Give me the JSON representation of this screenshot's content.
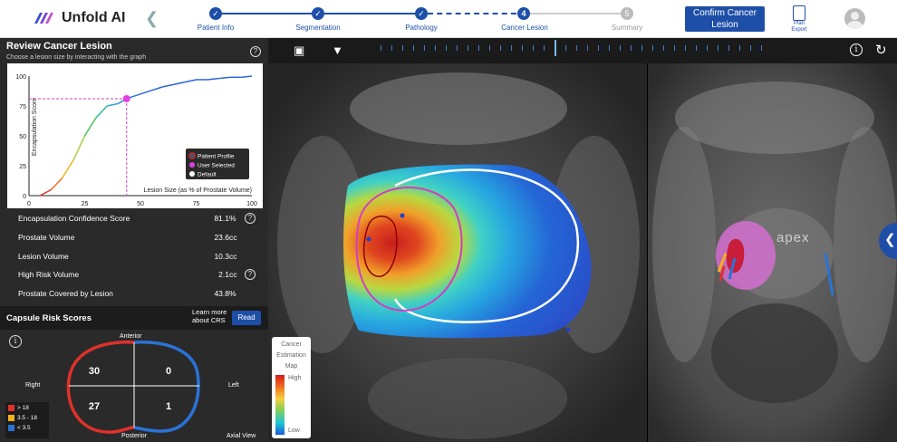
{
  "header": {
    "app_name": "Unfold AI",
    "steps": [
      {
        "number": "",
        "label": "Patient Info",
        "state": "done"
      },
      {
        "number": "",
        "label": "Segmentation",
        "state": "done"
      },
      {
        "number": "",
        "label": "Pathology",
        "state": "done"
      },
      {
        "number": "4",
        "label": "Cancer Lesion",
        "state": "current"
      },
      {
        "number": "5",
        "label": "Summary",
        "state": "todo"
      }
    ],
    "confirm_label": "Confirm Cancer Lesion",
    "plan_export_label": "Plan Export"
  },
  "review": {
    "title": "Review Cancer Lesion",
    "subtitle": "Choose a lesion size by interacting with the graph"
  },
  "chart_data": {
    "type": "line",
    "title": "",
    "xlabel": "Lesion Size (as % of Prostate Volume)",
    "ylabel": "Encapsulation Score",
    "xlim": [
      0,
      100
    ],
    "ylim": [
      0,
      100
    ],
    "x_ticks": [
      "0",
      "25",
      "50",
      "75",
      "100"
    ],
    "y_ticks": [
      "0",
      "25",
      "50",
      "75",
      "100"
    ],
    "series": [
      {
        "x": [
          5,
          10,
          15,
          20,
          25,
          30,
          35,
          40,
          43.8,
          50,
          55,
          60,
          65,
          70,
          75,
          80,
          85,
          90,
          95,
          100
        ],
        "y": [
          0,
          5,
          15,
          30,
          50,
          65,
          75,
          77,
          81.1,
          85,
          88,
          91,
          93,
          95,
          97,
          97,
          98,
          99,
          99,
          100
        ]
      }
    ],
    "selected_point": {
      "x": 43.8,
      "y": 81.1
    },
    "legend": [
      "Patient Profile",
      "User Selected",
      "Default"
    ],
    "legend_position": "bottom-right"
  },
  "metrics": [
    {
      "label": "Encapsulation Confidence Score",
      "value": "81.1",
      "unit": "%",
      "help": true
    },
    {
      "label": "Prostate Volume",
      "value": "23.6",
      "unit": "cc",
      "help": false
    },
    {
      "label": "Lesion Volume",
      "value": "10.3",
      "unit": "cc",
      "help": false
    },
    {
      "label": "High Risk Volume",
      "value": "2.1",
      "unit": "cc",
      "help": true
    },
    {
      "label": "Prostate Covered by Lesion",
      "value": "43.8",
      "unit": "%",
      "help": false
    }
  ],
  "crs": {
    "title": "Capsule Risk Scores",
    "learn_more": "Learn more about CRS",
    "read_label": "Read",
    "anterior": "Anterior",
    "posterior": "Posterior",
    "right": "Right",
    "left": "Left",
    "view": "Axial View",
    "quadrants": {
      "top_left": "30",
      "top_right": "0",
      "bottom_left": "27",
      "bottom_right": "1"
    },
    "legend": [
      {
        "label": "> 18",
        "color": "#e0312b"
      },
      {
        "label": "3.5 - 18",
        "color": "#f2b21b"
      },
      {
        "label": "< 3.5",
        "color": "#2a73d6"
      }
    ]
  },
  "viewer": {
    "cem_title": "Cancer Estimation Map",
    "cem_high": "High",
    "cem_low": "Low",
    "apex_label": "apex"
  }
}
